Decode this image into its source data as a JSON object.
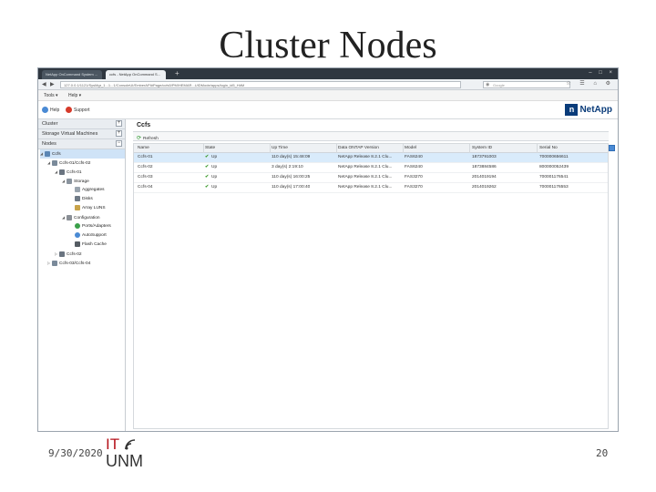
{
  "slide": {
    "title": "Cluster Nodes",
    "date": "9/30/2020",
    "page_number": "20",
    "logo_top": "IT",
    "logo_bottom": "UNM"
  },
  "browser": {
    "tabs": [
      {
        "label": "NetApp OnCommand System ..."
      },
      {
        "label": "ccfs - NetApp OnCommand S..."
      }
    ],
    "new_tab": "+",
    "url": "127.0.0.1/1121/SysMgr_1...1...1/ConsoleUI/EmberAPI#Page/ccfs5/PM/HEMAR...UIDMode/apps/login_id5_H#M",
    "search_placeholder": "Google"
  },
  "menubar": {
    "items": [
      "Tools ▾",
      "Help ▾"
    ]
  },
  "helpbar": {
    "help_label": "Help",
    "support_label": "Support",
    "logo_text": "NetApp"
  },
  "sidebar": {
    "sections": [
      {
        "label": "Cluster",
        "toggle": "+"
      },
      {
        "label": "Storage Virtual Machines",
        "toggle": "+"
      },
      {
        "label": "Nodes",
        "toggle": "−"
      }
    ],
    "tree": [
      {
        "label": "Ccfs",
        "selected": true,
        "icon": "cluster-icon"
      },
      {
        "label": "Ccfs-01/Ccfs-02",
        "icon": "ha-pair-icon"
      },
      {
        "label": "Ccfs-01",
        "icon": "node-icon"
      },
      {
        "label": "Storage",
        "icon": "storage-icon"
      },
      {
        "label": "Aggregates",
        "icon": "aggregate-icon"
      },
      {
        "label": "Disks",
        "icon": "disk-icon"
      },
      {
        "label": "Array LUNS",
        "icon": "lun-icon"
      },
      {
        "label": "Configuration",
        "icon": "configuration-icon"
      },
      {
        "label": "Ports/Adapters",
        "icon": "port-icon"
      },
      {
        "label": "AutoSupport",
        "icon": "autosupport-icon"
      },
      {
        "label": "Flash Cache",
        "icon": "flash-cache-icon"
      },
      {
        "label": "Ccfs-02",
        "icon": "node-icon"
      },
      {
        "label": "Ccfs-03/Ccfs-04",
        "icon": "ha-pair-icon"
      }
    ]
  },
  "main": {
    "heading": "Ccfs",
    "refresh_label": "Refresh",
    "columns": [
      "Name",
      "State",
      "Up Time",
      "Data ONTAP Version",
      "Model",
      "System ID",
      "Serial No"
    ],
    "rows": [
      {
        "name": "Ccfs-01",
        "state": "Up",
        "uptime": "110 day(s) 15:48:09",
        "version": "NetApp Release 8.2.1 Clu...",
        "model": "FAS6240",
        "system_id": "1873791003",
        "serial": "700000656611"
      },
      {
        "name": "Ccfs-02",
        "state": "Up",
        "uptime": "3 day(s) 2:19:10",
        "version": "NetApp Release 8.2.1 Clu...",
        "model": "FAS6240",
        "system_id": "1873884586",
        "serial": "800000052439"
      },
      {
        "name": "Ccfs-03",
        "state": "Up",
        "uptime": "110 day(s) 16:00:25",
        "version": "NetApp Release 8.2.1 Clu...",
        "model": "FAS3270",
        "system_id": "2014019194",
        "serial": "700001176541"
      },
      {
        "name": "Ccfs-04",
        "state": "Up",
        "uptime": "110 day(s) 17:00:40",
        "version": "NetApp Release 8.2.1 Clu...",
        "model": "FAS3270",
        "system_id": "2014019262",
        "serial": "700001176553"
      }
    ]
  },
  "colors": {
    "accent": "#0a3c7a",
    "status_up": "#3a9a2a",
    "selection": "#d9ebfb",
    "brand_red": "#b5121b"
  }
}
